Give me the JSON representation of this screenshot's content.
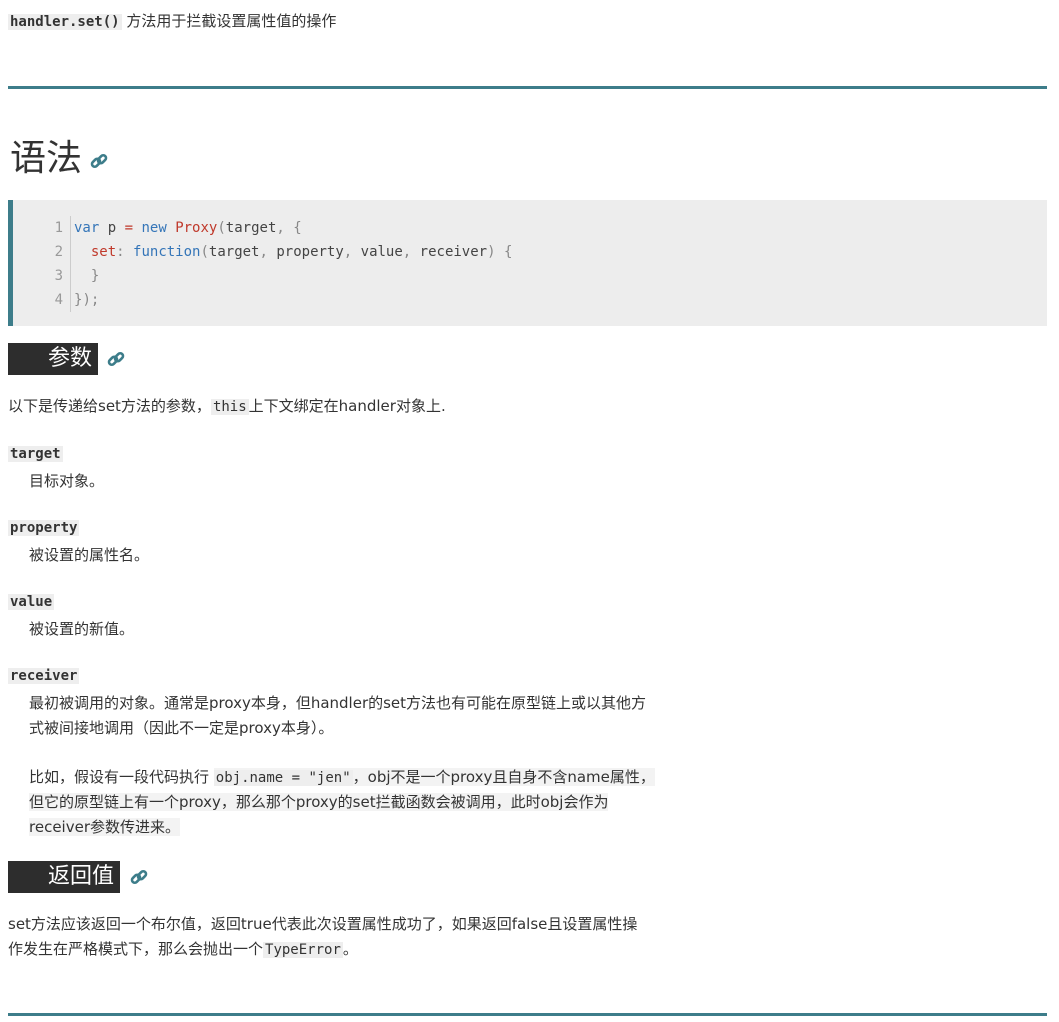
{
  "intro": {
    "code": "handler.set()",
    "text": " 方法用于拦截设置属性值的操作"
  },
  "syntax": {
    "heading": "语法",
    "link_icon": "link-icon",
    "code_lines": [
      {
        "num": "1",
        "text": "var p = new Proxy(target, {"
      },
      {
        "num": "2",
        "text": "  set: function(target, property, value, receiver) {"
      },
      {
        "num": "3",
        "text": "  }"
      },
      {
        "num": "4",
        "text": "});"
      }
    ]
  },
  "params": {
    "heading": "参数",
    "intro_a": "以下是传递给set方法的参数，",
    "intro_code": "this",
    "intro_b": "上下文绑定在handler对象上.",
    "items": [
      {
        "name": "target",
        "desc": "目标对象。"
      },
      {
        "name": "property",
        "desc": "被设置的属性名。"
      },
      {
        "name": "value",
        "desc": "被设置的新值。"
      },
      {
        "name": "receiver",
        "desc_1": "最初被调用的对象。通常是proxy本身，但handler的set方法也有可能在原型链上或以其他方",
        "desc_2": "式被间接地调用（因此不一定是proxy本身）。"
      }
    ],
    "example": {
      "line1_a": "比如，假设有一段代码执行 ",
      "line1_code": "obj.name = \"jen\"",
      "line1_b": "，obj不是一个proxy且自身不含name属性，",
      "line2": "但它的原型链上有一个proxy，那么那个proxy的set拦截函数会被调用，此时obj会作为",
      "line3": "receiver参数传进来。"
    }
  },
  "returns": {
    "heading": "返回值",
    "line1": "set方法应该返回一个布尔值，返回true代表此次设置属性成功了，如果返回false且设置属性操",
    "line2_a": "作发生在严格模式下，那么会抛出一个",
    "line2_code": "TypeError",
    "line2_b": "。"
  },
  "colors": {
    "accent": "#3d7d8a",
    "heading_bg": "#2d2d2d",
    "code_bg": "#ededed",
    "keyword": "#3475b8",
    "function": "#c0392b"
  }
}
